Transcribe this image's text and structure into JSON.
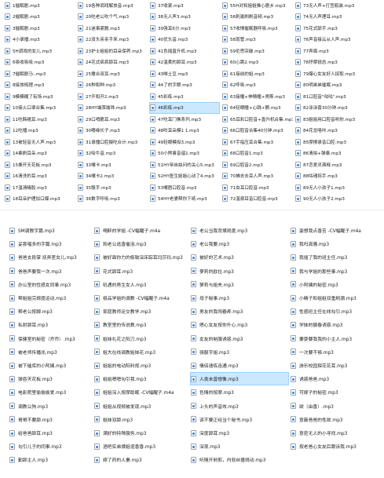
{
  "top_grid": [
    [
      "1催眠剧.mp3",
      "19各种调戏解放音.mp3",
      "37收紧.mp3",
      "55H对和姐姐推心剧乡.mp3",
      "73无人声+打签瓶装.mp3"
    ],
    [
      "2催眠剧.mp3",
      "20吃老公吹个气.mp3",
      "38无人声3.mp3",
      "56刺激刷刷音频.mp3",
      "74无人声理耳.mp3"
    ],
    [
      "3催眠剧.mp3",
      "21迷事紧脆.mp3",
      "39强耳6分.mp3",
      "57收情催眠器呼吸.mp3",
      "75花式舔手.mp3"
    ],
    [
      "4小录播.mp3",
      "22双头亲亲手来.mp3",
      "40优头音.mp3",
      "58现管.mp3",
      "76声音接云从人声.mp3"
    ],
    [
      "5H调戏的女儿.mp3",
      "23护士姐姐的耳朵保养.mp3",
      "41色摇直升机.mp3",
      "59伦思突破.mp3",
      "77弄面.mp3"
    ],
    [
      "6吸收吸吸.mp3",
      "24花式疯疯舔耳.mp3",
      "42温柔的舔耳.mp3",
      "60心跳2.mp3",
      "78抒摩锐态.mp3"
    ],
    [
      "7催眠剧马-.mp3",
      "25撒合双耳.mp3",
      "43唯土豆.mp3",
      "61接前的姐.mp3",
      "79爆心女友好人捉取.mp3"
    ],
    [
      "8接旅梳理.mp3",
      "26种和种.mp3",
      "44了的字眼.mp3",
      "62呼吸.mp3",
      "80明弟弟催眠.mp3"
    ],
    [
      "9模模糊了有场.mp3",
      "27开和开2.mp3",
      "45彩练.mp3",
      "63接瞳+伸睛瞳+男斯.mp3",
      "81口腔音\"咕咕\".mp3"
    ],
    [
      "10接火口罩合集.mp3",
      "28HY端菜瑜珠.mp3",
      "46彩练.mp3",
      "64轻眼瞳+心跳+颤.mp3",
      "82涂涂喜30分钟.mp3"
    ],
    [
      "11吃韩裙耳.mp3",
      "29口哨脆耳.mp3",
      "47吃耳门佛系列.mp3",
      "65耳彩口腔音+直升机合集.mp3",
      "83姐姐用口腔音哄你.mp3"
    ],
    [
      "12吃播.mp3",
      "30嘟缘长子.mp3",
      "48吹耳朵模1 1.mp3",
      "66口腔音合集40分钟.mp3",
      "84花龙咯咔.mp3"
    ],
    [
      "13被轻音无人声.mp3",
      "31录播口腔摄吃合计.mp3",
      "49轻眼模拟3.mp3",
      "67手指压耳合集.mp3",
      "85摩擦录音口腔.mp3"
    ],
    [
      "14乘刷耳朵.mp3",
      "32吸牛音.mp3",
      "50小熊事音谐1.mp3",
      "68口腔音1.mp3",
      "86清拍+弹奏.mp3"
    ],
    [
      "15撕开天花板.mp3",
      "33嘴卡.mp3",
      "51HY帝自拍问的关心5.mp3",
      "69口腔音2.mp3",
      "87恋爱灵弗释.mp3"
    ],
    [
      "16清洗的耳.mp3",
      "34嘴卡2.mp3",
      "52HY医生姐姐心动了4.mp3",
      "70拂去去耳人声.mp3",
      "88咕魂拐手.mp3"
    ],
    [
      "17温清曦胶.mp3",
      "35骰手.mp3",
      "53嘴唇口腔音.mp3",
      "71虫耳口腔音.mp3",
      "89无人小孩子1.mp3"
    ],
    [
      "18耳朵护理加口爆.mp3",
      "36数字呼吸.mp3",
      "54HY老婆帮你下纸.mp3",
      "72温泉耳音口腔音.mp3",
      "90无人小孩子2.mp3"
    ]
  ],
  "bottom_grid": [
    [
      "SM调教字篇.mp3",
      "喝醉的学姐 -CV幅醒子.m4a",
      "老公当我背揉闹度.mp3",
      "姿想我点香苦 -CV幅醒子.m4a"
    ],
    [
      "妥那唱多的字篇.mp3",
      "和老公逃香催泡.mp3",
      "老公我要.mp3",
      "我吗真骚.mp3"
    ],
    [
      "爸爸支段掌 抚弄差女儿.mp3",
      "被好面你力的极致深床踪耳玛莎玛.mp3",
      "被好的艺术.mp3",
      "我插了我的班主任.mp3"
    ],
    [
      "爸爸声要我一次.mp3",
      "花式舔耳.mp3",
      "萝莉的欧拉.mp3",
      "我与学姐的那些事.mp3"
    ],
    [
      "办公室的性感女同事.mp3",
      "吼遇的男生女人.mp3",
      "萝莉与姐夫.mp3",
      "小阿姨的秘密.mp3"
    ],
    [
      "帮姐姐完嫁度运动.mp3",
      "极品学姐的调教 -CV幅醒子.m4a",
      "母子秘事.mp3",
      "小精子和姐姐双重刷潮.mp3"
    ],
    [
      "帮老公按脚.mp3",
      "家庭教师足交教学.mp3",
      "男友的我闹春疼.mp3",
      "性感班主任在线勾引.mp3"
    ],
    [
      "私射舔耳.mp3",
      "教室里的传说教.mp3",
      "嗯心女友按你升心.mp3",
      "学妹的摄春诱惑.mp3"
    ],
    [
      "保健室的秘密（乔乔）.mp3",
      "姐妹礼花之阳刀.mp3",
      "女友的制服诱惑.mp3",
      "要耍要我我的小主人.mp3"
    ],
    [
      "被老师传播兆.mp3",
      "姐大在线调教姐妹花.mp3",
      "强服字姐.mp3",
      "一次要不够.mp3"
    ],
    [
      "被下催库的小阿姨.mp3",
      "姐姐的电动阳利规.mp3",
      "情侣速练连通.mp3",
      "游乐校园探花花耳.mp3"
    ],
    [
      "弹吞天花板.mp3",
      "姐姐嗯嗯勾引我.mp3",
      "人类未曾想像.mp3",
      "诱惑爸爸.mp3"
    ],
    [
      "电影院里偷偷偷爱.mp3",
      "姐姐深入按摩助眠 -CV幅醒子.m4a",
      "色情的按摩.mp3",
      "可嫁子的秘密.mp3"
    ],
    [
      "调教公狗.mp3",
      "姐姐从视频被发现.mp3",
      "上头的声音效.mp3",
      "欲（由香）.mp3"
    ],
    [
      "哥哥不要舔.mp3",
      "姐妹双舔.mp3",
      "读不要正经当个秘书.mp3",
      "意蔽爸爸的性欲.mp3"
    ],
    [
      "给爸爸舔耳.mp3",
      "满好的特殊服务.mp3",
      "深度舔耳.mp3",
      "意密无人的小寻找.mp3"
    ],
    [
      "勾引儿子的同事.mp3",
      "酒吧实弟揉姐谊香香.mp3",
      "深夜.mp3",
      "按老爸心女友后跟诉我.mp3"
    ],
    [
      "勤舔主人.mp3",
      "嫁了药的人妻.mp3",
      "听随开剁剪，内软丝撞挠动.mp3",
      ""
    ]
  ],
  "selected_top": "46彩练.mp3",
  "selected_bottom": "人类未曾想像.mp3",
  "colors": {
    "selection_bg": "#cce8ff",
    "selection_border": "#99d1ff",
    "icon_accent": "#3b7fd4"
  }
}
